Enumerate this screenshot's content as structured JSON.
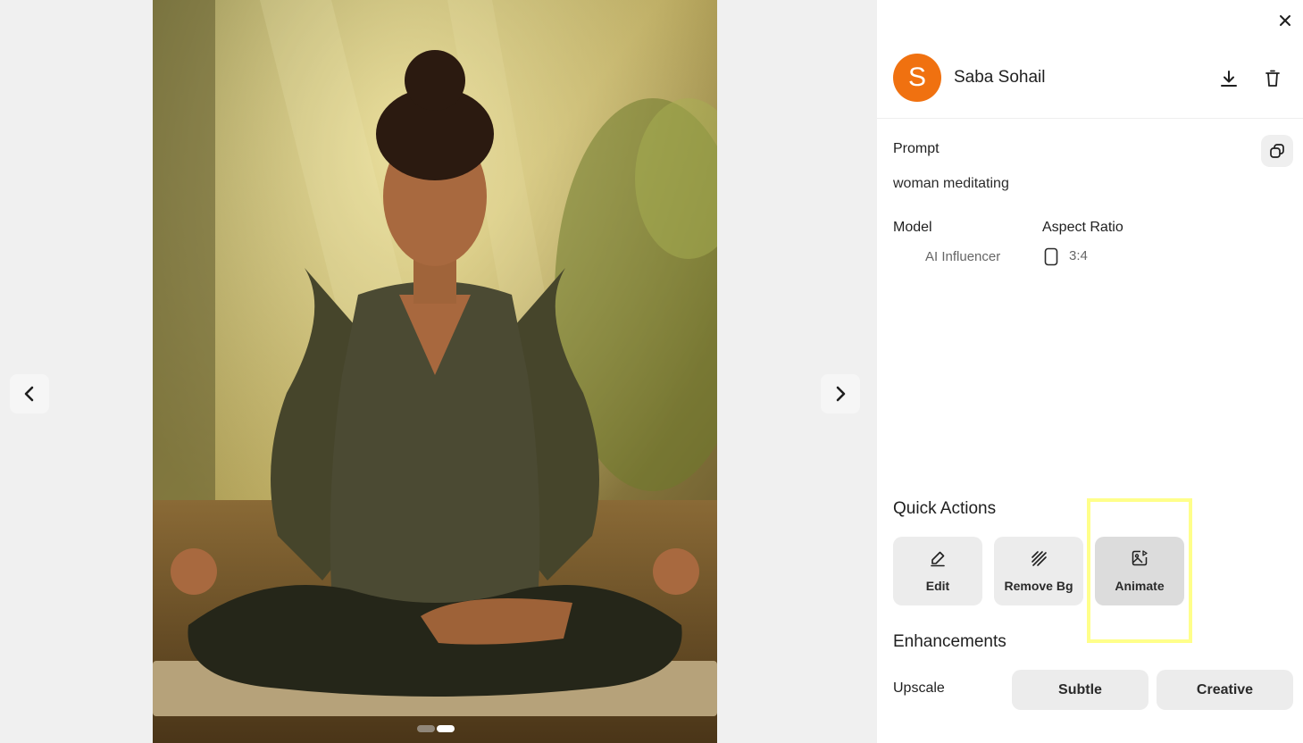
{
  "user": {
    "name": "Saba Sohail",
    "initial": "S",
    "avatar_color": "#f07110"
  },
  "details": {
    "prompt_label": "Prompt",
    "prompt_text": "woman meditating",
    "model_label": "Model",
    "model_value": "AI Influencer",
    "aspect_label": "Aspect Ratio",
    "aspect_value": "3:4"
  },
  "quick_actions": {
    "title": "Quick Actions",
    "items": [
      {
        "label": "Edit",
        "icon": "pencil-icon"
      },
      {
        "label": "Remove Bg",
        "icon": "remove-bg-icon"
      },
      {
        "label": "Animate",
        "icon": "animate-image-icon"
      }
    ]
  },
  "enhancements": {
    "title": "Enhancements",
    "upscale_label": "Upscale",
    "options": [
      "Subtle",
      "Creative"
    ]
  },
  "carousel": {
    "count": 2,
    "active": 2
  },
  "icons": {
    "close": "close-icon",
    "download": "download-icon",
    "delete": "trash-icon",
    "copy": "copy-icon",
    "prev": "chevron-left-icon",
    "next": "chevron-right-icon",
    "aspect": "portrait-rectangle-icon"
  },
  "colors": {
    "highlight": "#ffff8a",
    "button_bg": "#ececec"
  }
}
